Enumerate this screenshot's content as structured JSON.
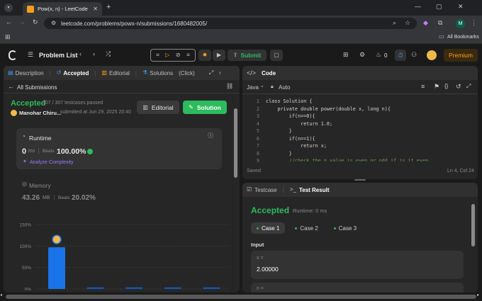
{
  "browser": {
    "tab_title": "Pow(x, n) - LeetCode",
    "url": "leetcode.com/problems/powx-n/submissions/1680482005/",
    "bookmarks_label": "All Bookmarks",
    "profile_initial": "M"
  },
  "nav": {
    "problem_list": "Problem List",
    "submit": "Submit",
    "streak": "0",
    "premium": "Premium"
  },
  "left": {
    "tabs": {
      "description": "Description",
      "accepted": "Accepted",
      "editorial": "Editorial",
      "solutions": "Solutions",
      "click": "(Click)"
    },
    "back_label": "All Submissions",
    "status": "Accepted",
    "testcases": "307 / 307 testcases passed",
    "user": "Manohar Chiru...",
    "submitted": "submitted at Jun 29, 2025 20:40",
    "editorial_btn": "Editorial",
    "solution_btn": "Solution",
    "runtime": {
      "label": "Runtime",
      "value": "0",
      "unit": "ms",
      "beats_label": "Beats",
      "beats": "100.00%",
      "analyze": "Analyze Complexity"
    },
    "memory": {
      "label": "Memory",
      "value": "43.26",
      "unit": "MB",
      "beats_label": "Beats",
      "beats": "20.02%"
    }
  },
  "chart_data": {
    "type": "bar",
    "yticks": [
      "150%",
      "100%",
      "50%",
      "0%"
    ],
    "ylim": [
      0,
      150
    ],
    "values": [
      97,
      4,
      4,
      4,
      4
    ],
    "highlight_index": 0
  },
  "code": {
    "title": "Code",
    "language": "Java",
    "mode": "Auto",
    "saved": "Saved",
    "cursor": "Ln 4, Col 24",
    "lines": [
      "class Solution {",
      "    private double power(double x, long n){",
      "        if(n==0){",
      "            return 1.0;",
      "        }",
      "        if(n==1){",
      "            return x;",
      "        }",
      "        //check the n value is even or odd if is it even"
    ]
  },
  "test": {
    "tab_testcase": "Testcase",
    "tab_result": "Test Result",
    "status": "Accepted",
    "runtime": "Runtime: 0 ms",
    "cases": [
      "Case 1",
      "Case 2",
      "Case 3"
    ],
    "input_label": "Input",
    "var_name": "x =",
    "var_value": "2.00000",
    "next_var": "n ="
  },
  "colors": {
    "accent_green": "#2cbb5d",
    "bar_blue": "#1a73e8",
    "premium": "#ffa116"
  }
}
